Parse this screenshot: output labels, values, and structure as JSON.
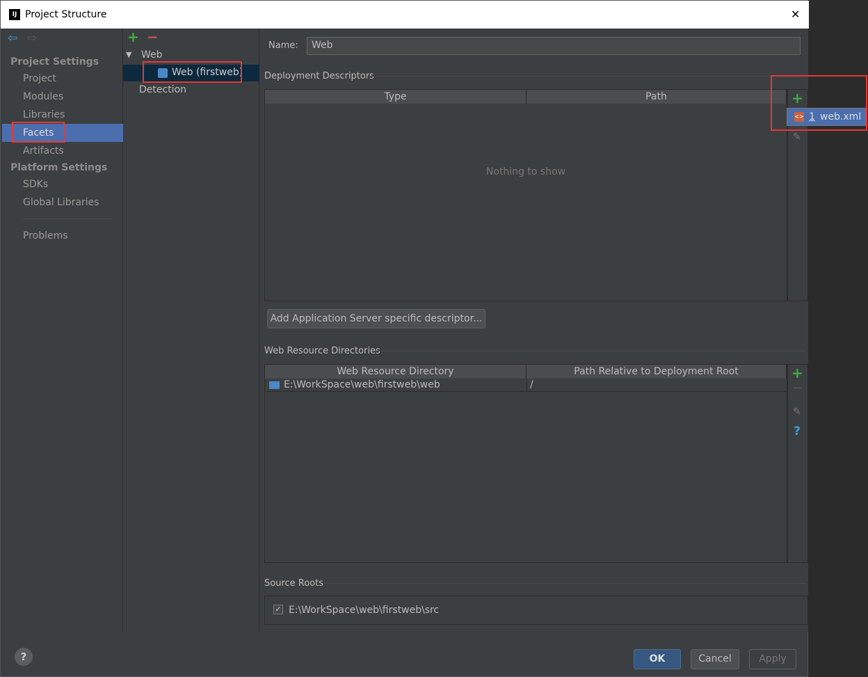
{
  "window": {
    "title": "Project Structure",
    "close": "✕"
  },
  "sidebar": {
    "project_settings": "Project Settings",
    "items": [
      "Project",
      "Modules",
      "Libraries",
      "Facets",
      "Artifacts"
    ],
    "platform_settings": "Platform Settings",
    "platform_items": [
      "SDKs",
      "Global Libraries"
    ],
    "problems": "Problems"
  },
  "tree": {
    "root": "Web",
    "child": "Web (firstweb)",
    "detection": "Detection"
  },
  "main": {
    "name_label": "Name:",
    "name_value": "Web",
    "deployment": {
      "title": "Deployment Descriptors",
      "columns": [
        "Type",
        "Path"
      ],
      "empty": "Nothing to show",
      "add_server_button": "Add Application Server specific descriptor...",
      "popup": {
        "index": "1",
        "label": "web.xml"
      }
    },
    "web_resources": {
      "title": "Web Resource Directories",
      "columns": [
        "Web Resource Directory",
        "Path Relative to Deployment Root"
      ],
      "rows": [
        {
          "dir": "E:\\WorkSpace\\web\\firstweb\\web",
          "path": "/"
        }
      ]
    },
    "source_roots": {
      "title": "Source Roots",
      "items": [
        {
          "checked": true,
          "path": "E:\\WorkSpace\\web\\firstweb\\src"
        }
      ]
    }
  },
  "footer": {
    "ok": "OK",
    "cancel": "Cancel",
    "apply": "Apply",
    "help": "?"
  },
  "colors": {
    "selection": "#4b6eaf",
    "highlight": "#e53935",
    "add": "#3fae3f"
  }
}
